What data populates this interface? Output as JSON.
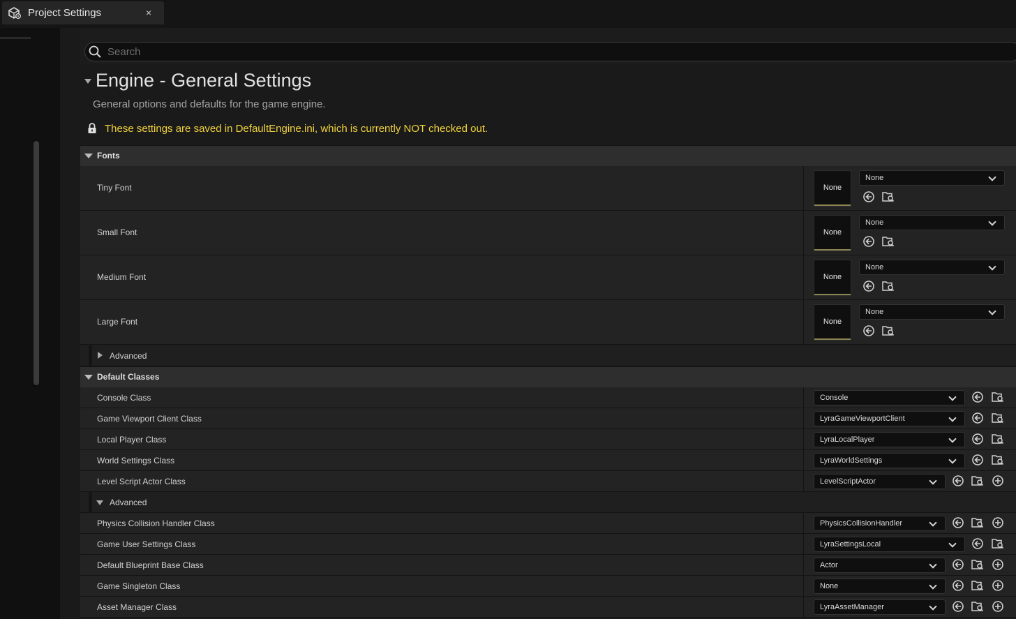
{
  "window": {
    "tab_title": "Project Settings",
    "close_glyph": "×"
  },
  "search": {
    "placeholder": "Search",
    "value": ""
  },
  "header": {
    "title": "Engine - General Settings",
    "description": "General options and defaults for the game engine.",
    "warning": "These settings are saved in DefaultEngine.ini, which is currently NOT checked out."
  },
  "sections": {
    "fonts": {
      "label": "Fonts",
      "rows": [
        {
          "label": "Tiny Font",
          "thumb": "None",
          "value": "None"
        },
        {
          "label": "Small Font",
          "thumb": "None",
          "value": "None"
        },
        {
          "label": "Medium Font",
          "thumb": "None",
          "value": "None"
        },
        {
          "label": "Large Font",
          "thumb": "None",
          "value": "None"
        }
      ],
      "advanced_label": "Advanced"
    },
    "default_classes": {
      "label": "Default Classes",
      "rows": [
        {
          "label": "Console Class",
          "value": "Console"
        },
        {
          "label": "Game Viewport Client Class",
          "value": "LyraGameViewportClient"
        },
        {
          "label": "Local Player Class",
          "value": "LyraLocalPlayer"
        },
        {
          "label": "World Settings Class",
          "value": "LyraWorldSettings"
        },
        {
          "label": "Level Script Actor Class",
          "value": "LevelScriptActor"
        }
      ],
      "advanced_label": "Advanced",
      "advanced_rows": [
        {
          "label": "Physics Collision Handler Class",
          "value": "PhysicsCollisionHandler"
        },
        {
          "label": "Game User Settings Class",
          "value": "LyraSettingsLocal"
        },
        {
          "label": "Default Blueprint Base Class",
          "value": "Actor"
        },
        {
          "label": "Game Singleton Class",
          "value": "None"
        },
        {
          "label": "Asset Manager Class",
          "value": "LyraAssetManager"
        }
      ]
    }
  },
  "icons": {
    "tab": "unreal-settings-icon",
    "search": "search-icon",
    "lock": "lock-icon",
    "use_selected": "use-selected-arrow-icon",
    "browse": "browse-folder-icon",
    "new": "plus-circle-icon"
  },
  "colors": {
    "warning": "#f2d33d",
    "panel": "#232323",
    "section_header": "#2e2e2e",
    "thumb_accent": "#8a8552"
  }
}
